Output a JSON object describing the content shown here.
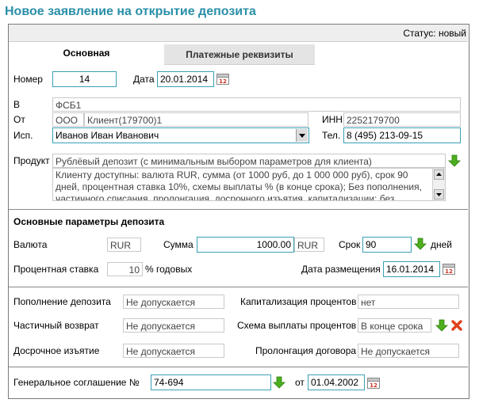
{
  "page_title": "Новое заявление на открытие депозита",
  "status": {
    "label": "Статус:",
    "value": "новый"
  },
  "tabs": [
    {
      "label": "Основная"
    },
    {
      "label": "Платежные реквизиты"
    }
  ],
  "number": {
    "label": "Номер",
    "value": "14"
  },
  "date": {
    "label": "Дата",
    "value": "20.01.2014"
  },
  "b": {
    "label": "В",
    "value": "ФСБ1"
  },
  "from": {
    "label": "От",
    "value1": "ООО",
    "value2": "Клиент(179700)1"
  },
  "inn": {
    "label": "ИНН",
    "value": "2252179700"
  },
  "executor": {
    "label": "Исп.",
    "value": "Иванов Иван Иванович"
  },
  "phone": {
    "label": "Тел.",
    "value": "8 (495) 213-09-15"
  },
  "product": {
    "label": "Продукт",
    "value": "Рублёвый депозит (с минимальным выбором параметров для клиента)",
    "description": "Клиенту доступны: валюта RUR, сумма (от 1000 руб, до 1 000 000 руб), срок 90 дней, процентная ставка 10%, схемы выплаты % (в конце срока); Без пополнения, частичного списания, пролонгация, досрочного изъятия, капитализации; без"
  },
  "section_main_params": "Основные параметры депозита",
  "currency": {
    "label": "Валюта",
    "value": "RUR"
  },
  "amount": {
    "label": "Сумма",
    "value": "1000.00",
    "currency": "RUR"
  },
  "term": {
    "label": "Срок",
    "value": "90",
    "unit": "дней"
  },
  "rate": {
    "label": "Процентная ставка",
    "value": "10",
    "unit": "% годовых"
  },
  "placement_date": {
    "label": "Дата размещения",
    "value": "16.01.2014"
  },
  "replenishment": {
    "label": "Пополнение депозита",
    "value": "Не допускается"
  },
  "capitalization": {
    "label": "Капитализация процентов",
    "value": "нет"
  },
  "partial_return": {
    "label": "Частичный возврат",
    "value": "Не допускается"
  },
  "payment_scheme": {
    "label": "Схема выплаты процентов",
    "value": "В конце срока"
  },
  "early_withdrawal": {
    "label": "Досрочное изъятие",
    "value": "Не допускается"
  },
  "prolongation": {
    "label": "Пролонгация договора",
    "value": "Не допускается"
  },
  "general_agreement": {
    "label": "Генеральное соглашение №",
    "value": "74-694",
    "from_label": "от",
    "date": "01.04.2002"
  },
  "calendar_icon_text": "12",
  "colors": {
    "title": "#2a8fa8",
    "accent_border": "#3aa0b4",
    "arrow_green": "#4caf1e",
    "delete_red": "#e0401a"
  }
}
